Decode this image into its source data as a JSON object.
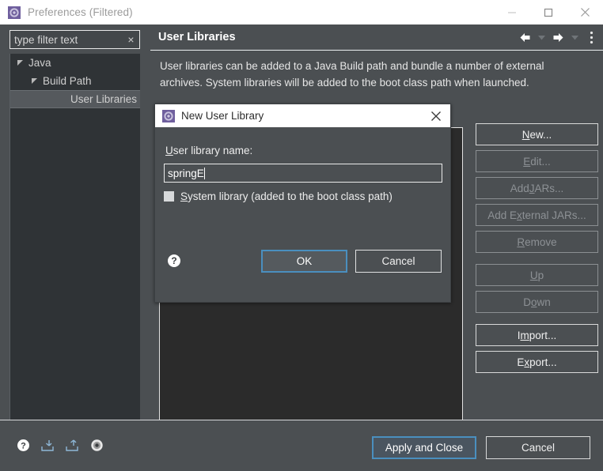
{
  "window": {
    "title": "Preferences (Filtered)",
    "icon": "preferences-gear-icon",
    "controls": {
      "minimize": "minimize-icon",
      "maximize": "maximize-icon",
      "close": "close-icon"
    }
  },
  "sidebar": {
    "filter": {
      "value": "type filter text",
      "placeholder": "type filter text",
      "clear_label": "×"
    },
    "tree": [
      {
        "label": "Java",
        "depth": 0,
        "expanded": true,
        "selected": false
      },
      {
        "label": "Build Path",
        "depth": 1,
        "expanded": true,
        "selected": false
      },
      {
        "label": "User Libraries",
        "depth": 2,
        "expanded": false,
        "selected": true
      }
    ]
  },
  "main": {
    "title": "User Libraries",
    "description": "User libraries can be added to a Java Build path and bundle a number of external archives. System libraries will be added to the boot class path when launched.",
    "toolbar": [
      {
        "name": "back-icon",
        "enabled": true
      },
      {
        "name": "back-dropdown-icon",
        "enabled": false
      },
      {
        "name": "forward-icon",
        "enabled": true
      },
      {
        "name": "forward-dropdown-icon",
        "enabled": false
      },
      {
        "name": "view-menu-icon",
        "enabled": true
      }
    ],
    "buttons": [
      {
        "label": "New...",
        "mnemonic": "N",
        "enabled": true,
        "gap": false
      },
      {
        "label": "Edit...",
        "mnemonic": "E",
        "enabled": false,
        "gap": false
      },
      {
        "label": "Add JARs...",
        "mnemonic": "J",
        "enabled": false,
        "gap": false
      },
      {
        "label": "Add External JARs...",
        "mnemonic": "x",
        "enabled": false,
        "gap": false
      },
      {
        "label": "Remove",
        "mnemonic": "R",
        "enabled": false,
        "gap": false
      },
      {
        "label": "Up",
        "mnemonic": "U",
        "enabled": false,
        "gap": true
      },
      {
        "label": "Down",
        "mnemonic": "o",
        "enabled": false,
        "gap": false
      },
      {
        "label": "Import...",
        "mnemonic": "m",
        "enabled": true,
        "gap": true
      },
      {
        "label": "Export...",
        "mnemonic": "x",
        "enabled": true,
        "gap": false
      }
    ]
  },
  "footer": {
    "icons": [
      {
        "name": "help-icon"
      },
      {
        "name": "import-preferences-icon"
      },
      {
        "name": "export-preferences-icon"
      },
      {
        "name": "restore-defaults-icon"
      }
    ],
    "apply_label": "Apply and Close",
    "cancel_label": "Cancel"
  },
  "dialog": {
    "title": "New User Library",
    "icon": "preferences-gear-icon",
    "close_label": "×",
    "name_label": "User library name:",
    "name_value": "springE",
    "name_mnemonic": "U",
    "checkbox_label": "System library (added to the boot class path)",
    "checkbox_mnemonic": "S",
    "checkbox_checked": false,
    "help_icon": "help-icon",
    "ok_label": "OK",
    "cancel_label": "Cancel"
  },
  "colors": {
    "panel_bg": "#4b4f52",
    "tree_bg": "#2f3336",
    "list_bg": "#2b2b2b",
    "titlebar_bg": "#ffffff",
    "focus_blue": "#4a8fbf",
    "text": "#f0f0f0",
    "text_disabled": "#8d9195",
    "selection_bg": "#55595d"
  }
}
